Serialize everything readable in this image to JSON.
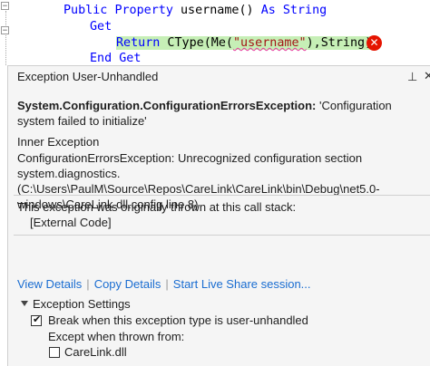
{
  "editor": {
    "line1": {
      "kw1": "Public",
      "kw2": "Property",
      "name": " username() ",
      "kw3": "As",
      "kw4": "String"
    },
    "line2": {
      "kw": "Get"
    },
    "line3": {
      "kw": "Return",
      "fn": " CType(Me(",
      "str": "\"username\"",
      "rest": "),String)"
    },
    "line4": {
      "kw1": "End",
      "kw2": "Get"
    },
    "error_glyph": "✕"
  },
  "helper": {
    "title": "Exception User-Unhandled",
    "pin_glyph": "⊥",
    "close_glyph": "✕",
    "exception_type": "System.Configuration.ConfigurationErrorsException:",
    "exception_message": " 'Configuration system failed to initialize'",
    "inner_heading": "Inner Exception",
    "inner_message": "ConfigurationErrorsException: Unrecognized configuration section system.diagnostics. (C:\\Users\\PaulM\\Source\\Repos\\CareLink\\CareLink\\bin\\Debug\\net5.0-windows\\CareLink.dll.config line 8)",
    "thrown_text": "This exception was originally thrown at this call stack:",
    "external_code": "[External Code]",
    "links": {
      "view_details": "View Details",
      "copy_details": "Copy Details",
      "live_share": "Start Live Share session..."
    },
    "settings": {
      "heading": "Exception Settings",
      "break_label": "Break when this exception type is user-unhandled",
      "break_checked": true,
      "except_label": "Except when thrown from:",
      "module_label": "CareLink.dll",
      "module_checked": false
    }
  }
}
